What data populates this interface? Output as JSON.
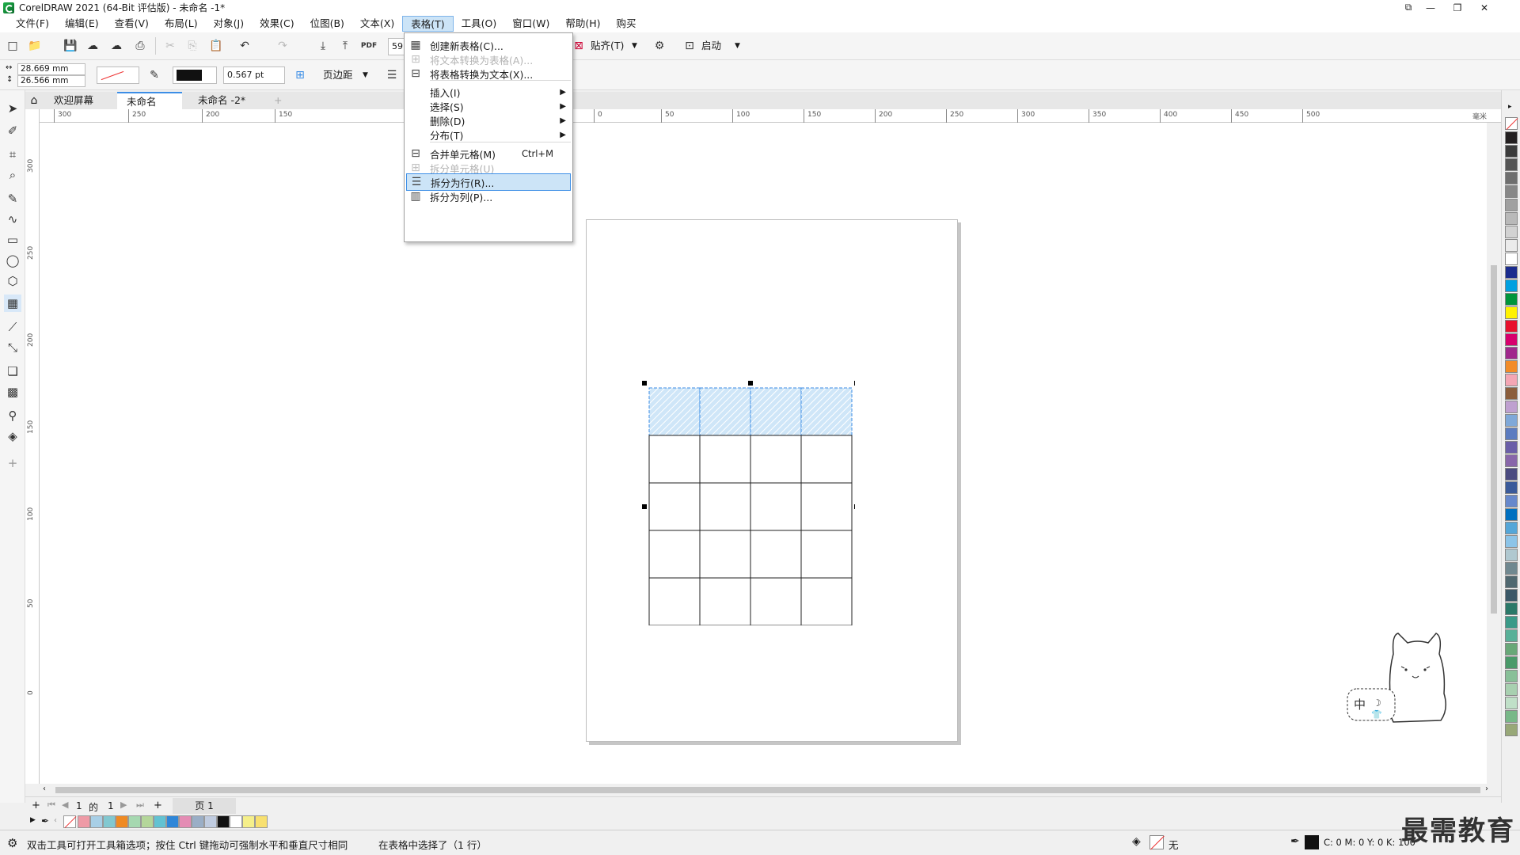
{
  "window": {
    "title": "CorelDRAW 2021 (64-Bit 评估版) - 未命名 -1*"
  },
  "menubar": {
    "items": [
      "文件(F)",
      "编辑(E)",
      "查看(V)",
      "布局(L)",
      "对象(J)",
      "效果(C)",
      "位图(B)",
      "文本(X)",
      "表格(T)",
      "工具(O)",
      "窗口(W)",
      "帮助(H)",
      "购买"
    ]
  },
  "toolbar": {
    "zoom_value": "59",
    "snap_label": "贴齐(T)",
    "launch_label": "启动",
    "width_value": "28.669 mm",
    "height_value": "26.566 mm",
    "outline_width": "0.567 pt",
    "page_margin_label": "页边距"
  },
  "tabs": {
    "welcome": "欢迎屏幕",
    "doc1": "未命名 -1*",
    "doc2": "未命名 -2*"
  },
  "ruler": {
    "h_labels": [
      "300",
      "250",
      "200",
      "150",
      "0",
      "50",
      "100",
      "150",
      "200",
      "250",
      "300",
      "350",
      "400",
      "450",
      "500"
    ],
    "unit": "毫米",
    "v_labels": [
      "300",
      "250",
      "200",
      "150",
      "100",
      "50",
      "0"
    ]
  },
  "table_menu": {
    "items": [
      {
        "label": "创建新表格(C)...",
        "enabled": true,
        "icon": "table-grid-icon"
      },
      {
        "label": "将文本转换为表格(A)...",
        "enabled": false,
        "icon": "text-to-table-icon"
      },
      {
        "label": "将表格转换为文本(X)...",
        "enabled": true,
        "icon": "table-to-text-icon"
      },
      {
        "label": "插入(I)",
        "enabled": true,
        "submenu": true
      },
      {
        "label": "选择(S)",
        "enabled": true,
        "submenu": true
      },
      {
        "label": "删除(D)",
        "enabled": true,
        "submenu": true
      },
      {
        "label": "分布(T)",
        "enabled": true,
        "submenu": true
      },
      {
        "label": "合并单元格(M)",
        "shortcut": "Ctrl+M",
        "enabled": true,
        "icon": "merge-cells-icon"
      },
      {
        "label": "拆分单元格(U)",
        "enabled": false,
        "icon": "split-cells-icon"
      },
      {
        "label": "拆分为行(R)...",
        "enabled": true,
        "highlighted": true,
        "icon": "split-rows-icon"
      },
      {
        "label": "拆分为列(P)...",
        "enabled": true,
        "icon": "split-columns-icon"
      }
    ]
  },
  "table": {
    "rows": 5,
    "cols": 4,
    "selected_row": 0
  },
  "page_nav": {
    "current": "1",
    "of_label": "的",
    "total": "1",
    "page_tab": "页 1"
  },
  "status": {
    "hint": "双击工具可打开工具箱选项；按住 Ctrl 键拖动可强制水平和垂直尺寸相同",
    "selection": "在表格中选择了（1 行）",
    "fill_label": "无",
    "cmyk": "C: 0 M: 0 Y: 0 K: 100"
  },
  "mascot": {
    "badge": "中"
  },
  "watermark": "最需教育",
  "colors": {
    "accent": "#3c8ee6",
    "selection_fill": "#cfe6f8",
    "doc_palette": [
      "#ee9aa6",
      "#a8cfe6",
      "#82c8d0",
      "#ef8a22",
      "#a6d8b0",
      "#b4d69a",
      "#62c2d2",
      "#2e86d8",
      "#e48cb4",
      "#9aaec6",
      "#c0cce0",
      "#111111",
      "#ffffff",
      "#f5ef8a",
      "#f8e070"
    ],
    "right_palette": [
      "#231f20",
      "#3b3b3b",
      "#555555",
      "#6e6e6e",
      "#878787",
      "#a0a0a0",
      "#b9b9b9",
      "#d2d2d2",
      "#ebebeb",
      "#ffffff",
      "#1b2c8e",
      "#00a0e0",
      "#00953b",
      "#fff200",
      "#e8112d",
      "#d7006d",
      "#a0288c",
      "#f28c28",
      "#f4a6b4",
      "#8b5e3c",
      "#bfa0d0",
      "#7fa8d8",
      "#5c7cc0",
      "#6a5ea8",
      "#8866aa",
      "#4a4a80",
      "#3a5a9a",
      "#6688cc",
      "#0070c0",
      "#54a6d8",
      "#8cc4e8",
      "#b0c8d0",
      "#708890",
      "#506870",
      "#3a5868",
      "#2a7868",
      "#3a9a88",
      "#58b098",
      "#68a878",
      "#4a9a6a",
      "#88c098",
      "#a8d0b0",
      "#c0e0c8",
      "#78b888",
      "#98a878"
    ]
  }
}
